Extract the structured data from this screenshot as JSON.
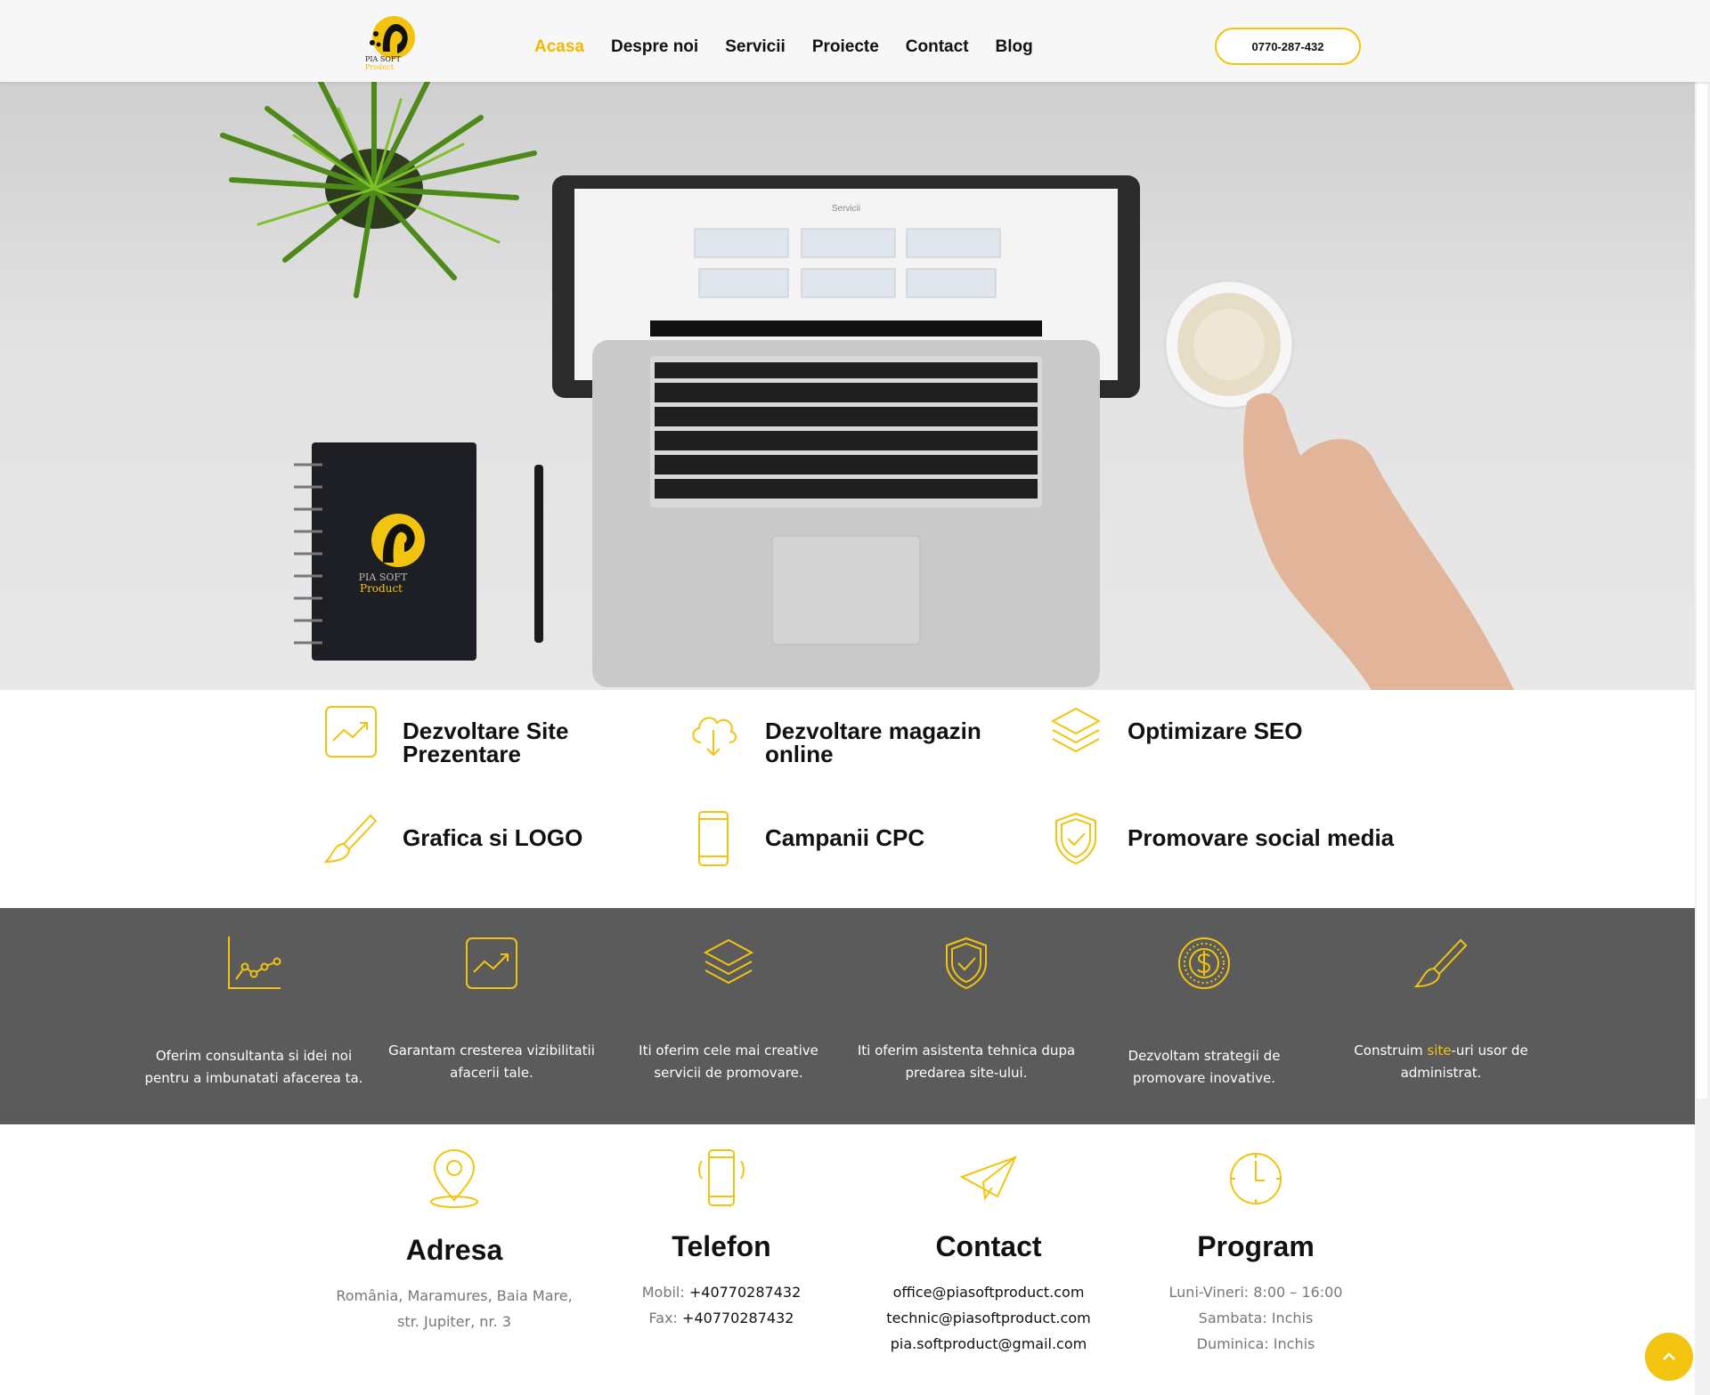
{
  "header": {
    "logo_line1": "PIA SOFT",
    "logo_line2": "Product",
    "nav": [
      {
        "label": "Acasa",
        "active": true
      },
      {
        "label": "Despre noi"
      },
      {
        "label": "Servicii"
      },
      {
        "label": "Proiecte"
      },
      {
        "label": "Contact"
      },
      {
        "label": "Blog"
      }
    ],
    "phone": "0770-287-432"
  },
  "hero": {
    "screen_title": "Servicii",
    "notebook_line1": "PIA SOFT",
    "notebook_line2": "Product"
  },
  "services": [
    {
      "title": "Dezvoltare Site Prezentare",
      "icon": "chart-square-icon"
    },
    {
      "title": "Dezvoltare magazin online",
      "icon": "cloud-download-icon"
    },
    {
      "title": "Optimizare SEO",
      "icon": "layers-icon"
    },
    {
      "title": "Grafica si LOGO",
      "icon": "brush-icon"
    },
    {
      "title": "Campanii CPC",
      "icon": "smartphone-icon"
    },
    {
      "title": "Promovare social media",
      "icon": "shield-check-icon"
    }
  ],
  "features": [
    {
      "text": "Oferim consultanta si idei noi pentru a imbunatati afacerea ta.",
      "icon": "line-chart-icon"
    },
    {
      "text": "Garantam cresterea vizibilitatii afacerii tale.",
      "icon": "chart-square-icon"
    },
    {
      "text": "Iti oferim cele mai creative servicii de promovare.",
      "icon": "layers-icon"
    },
    {
      "text": "Iti oferim asistenta tehnica dupa predarea site-ului.",
      "icon": "shield-check-icon"
    },
    {
      "text": "Dezvoltam strategii de promovare inovative.",
      "icon": "dollar-coin-icon"
    },
    {
      "text_before": "Construim ",
      "text_highlight": "site",
      "text_after": "-uri usor de administrat.",
      "icon": "brush-icon"
    }
  ],
  "info": {
    "address": {
      "title": "Adresa",
      "line1": "România, Maramures, Baia Mare,",
      "line2": "str. Jupiter, nr. 3"
    },
    "phone": {
      "title": "Telefon",
      "mobil_label": "Mobil:",
      "mobil_value": "+40770287432",
      "fax_label": "Fax:",
      "fax_value": "+40770287432"
    },
    "contact": {
      "title": "Contact",
      "email1": "office@piasoftproduct.com",
      "email2": "technic@piasoftproduct.com",
      "email3": "pia.softproduct@gmail.com"
    },
    "program": {
      "title": "Program",
      "line1": "Luni-Vineri: 8:00 – 16:00",
      "line2": "Sambata: Inchis",
      "line3": "Duminica: Inchis"
    }
  },
  "colors": {
    "accent": "#f2c40f",
    "dark_band": "#5b5b5b",
    "text": "#111111"
  },
  "back_to_top_icon": "chevron-up-icon"
}
